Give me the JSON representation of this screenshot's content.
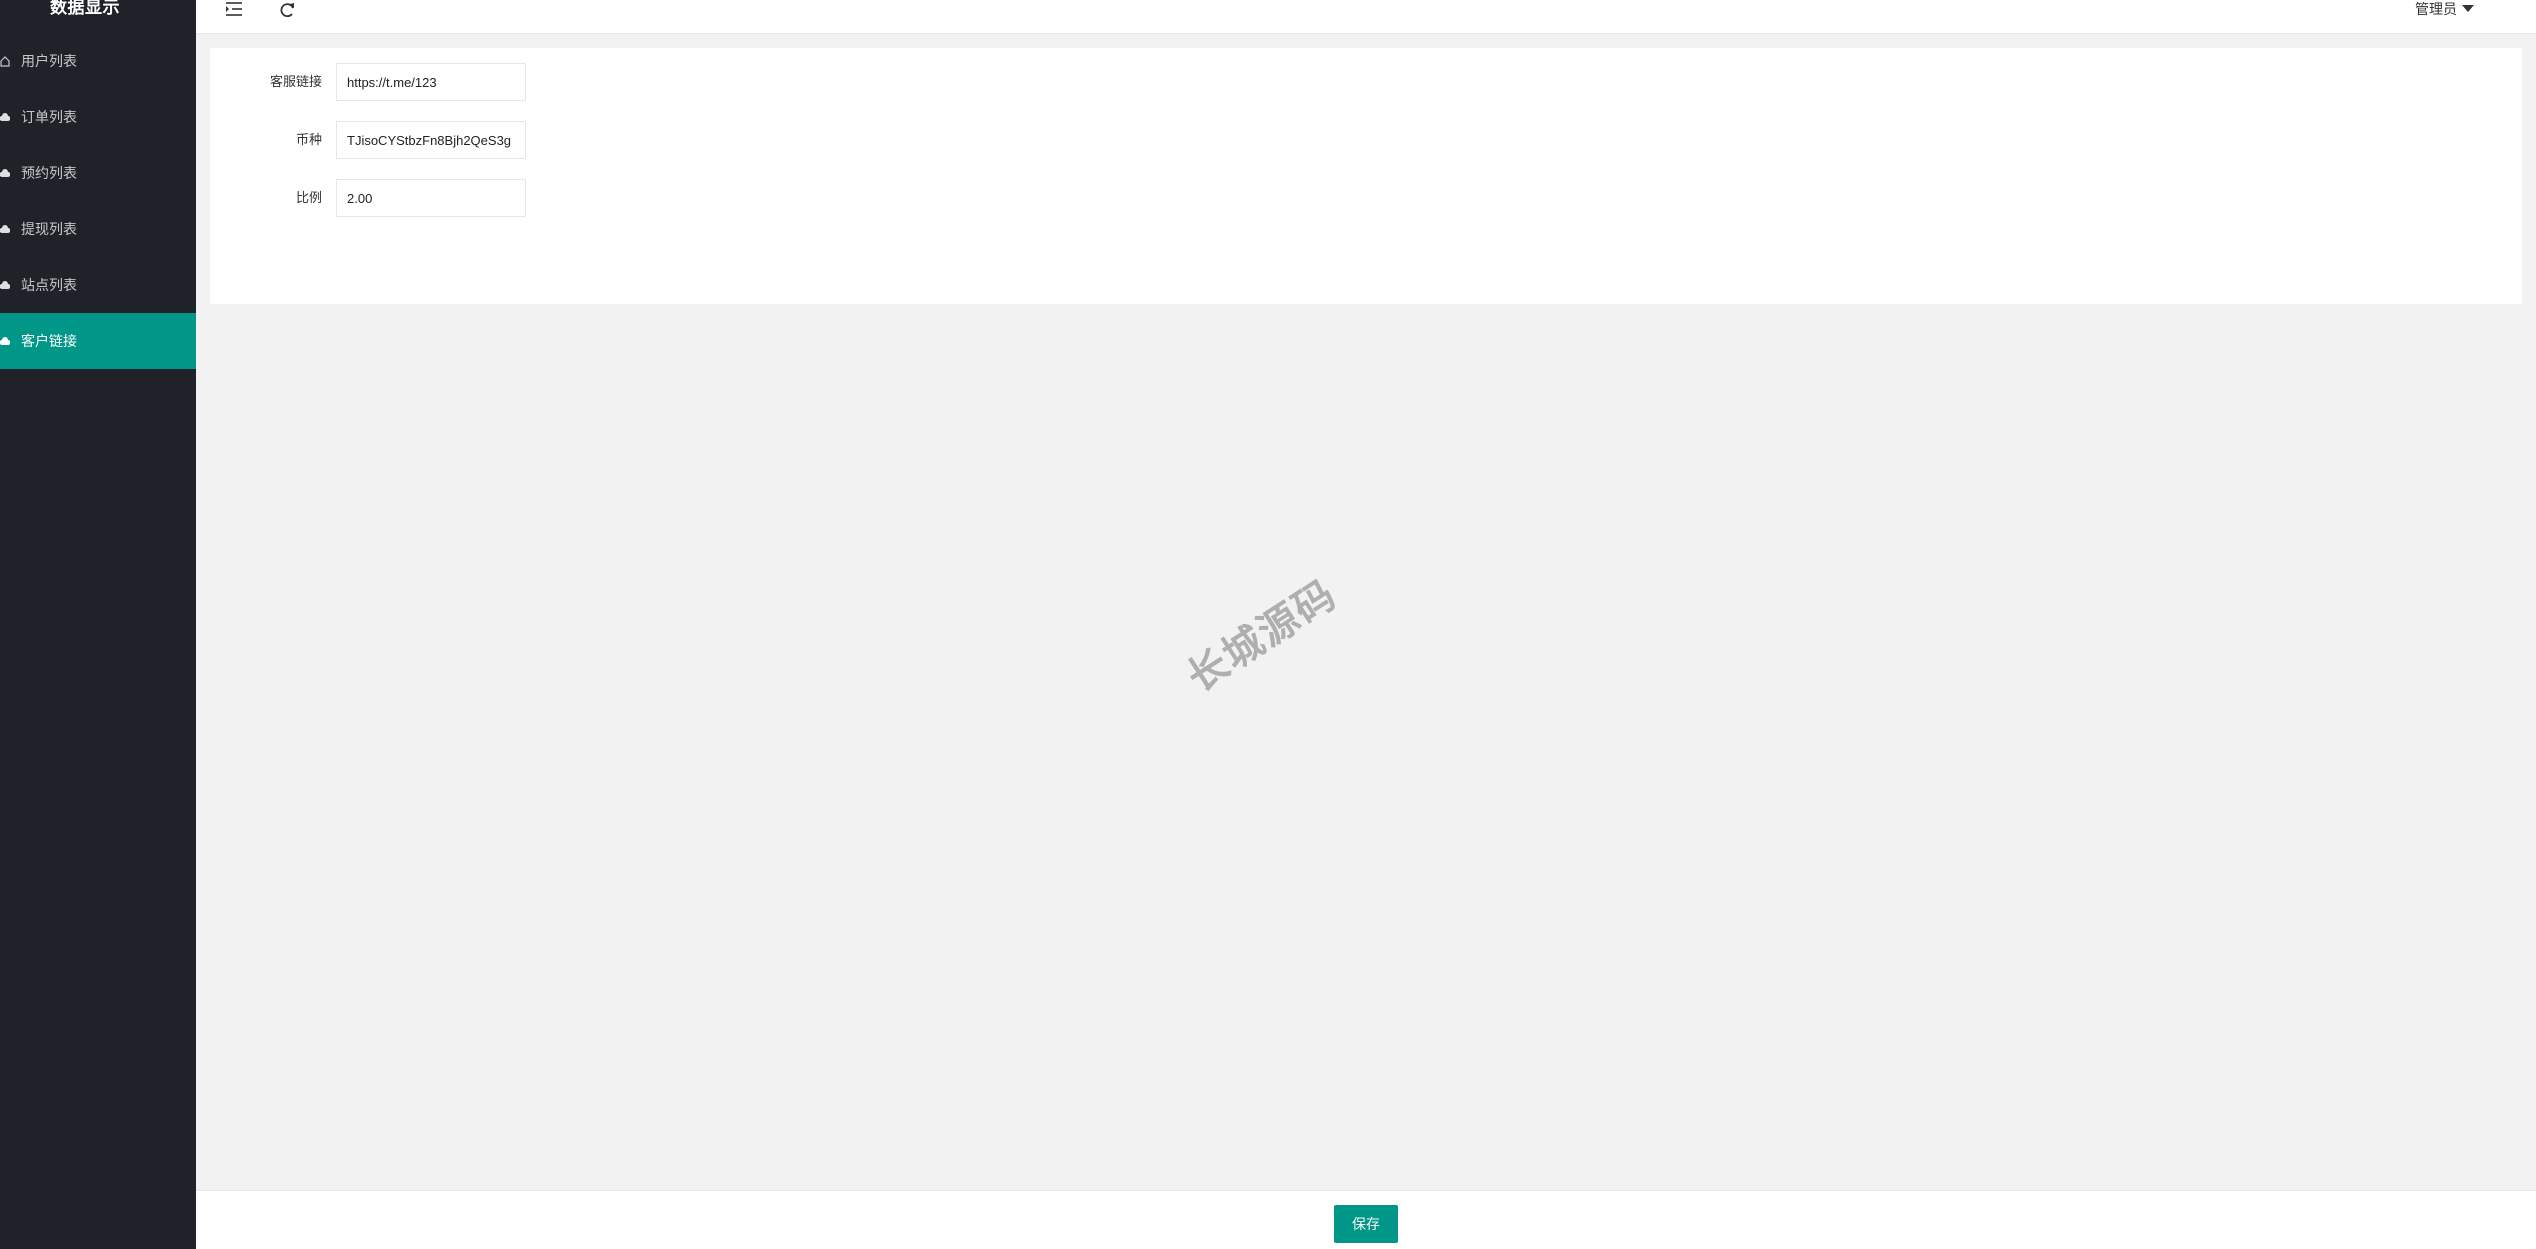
{
  "sidebar": {
    "logo": "数据显示",
    "items": [
      {
        "label": "用户列表",
        "icon": "home-icon",
        "active": false
      },
      {
        "label": "订单列表",
        "icon": "cloud-icon",
        "active": false
      },
      {
        "label": "预约列表",
        "icon": "cloud-icon",
        "active": false
      },
      {
        "label": "提现列表",
        "icon": "cloud-icon",
        "active": false
      },
      {
        "label": "站点列表",
        "icon": "cloud-icon",
        "active": false
      },
      {
        "label": "客户链接",
        "icon": "cloud-icon",
        "active": true
      }
    ]
  },
  "topbar": {
    "menu_toggle_icon": "menu-toggle-icon",
    "refresh_icon": "refresh-icon",
    "user_label": "管理员"
  },
  "form": {
    "fields": [
      {
        "label": "客服链接",
        "value": "https://t.me/123"
      },
      {
        "label": "币种",
        "value": "TJisoCYStbzFn8Bjh2QeS3g"
      },
      {
        "label": "比例",
        "value": "2.00"
      }
    ]
  },
  "watermark": "长城源码",
  "footer": {
    "save_label": "保存"
  },
  "colors": {
    "accent": "#009688",
    "sidebar_bg": "#20222a"
  }
}
